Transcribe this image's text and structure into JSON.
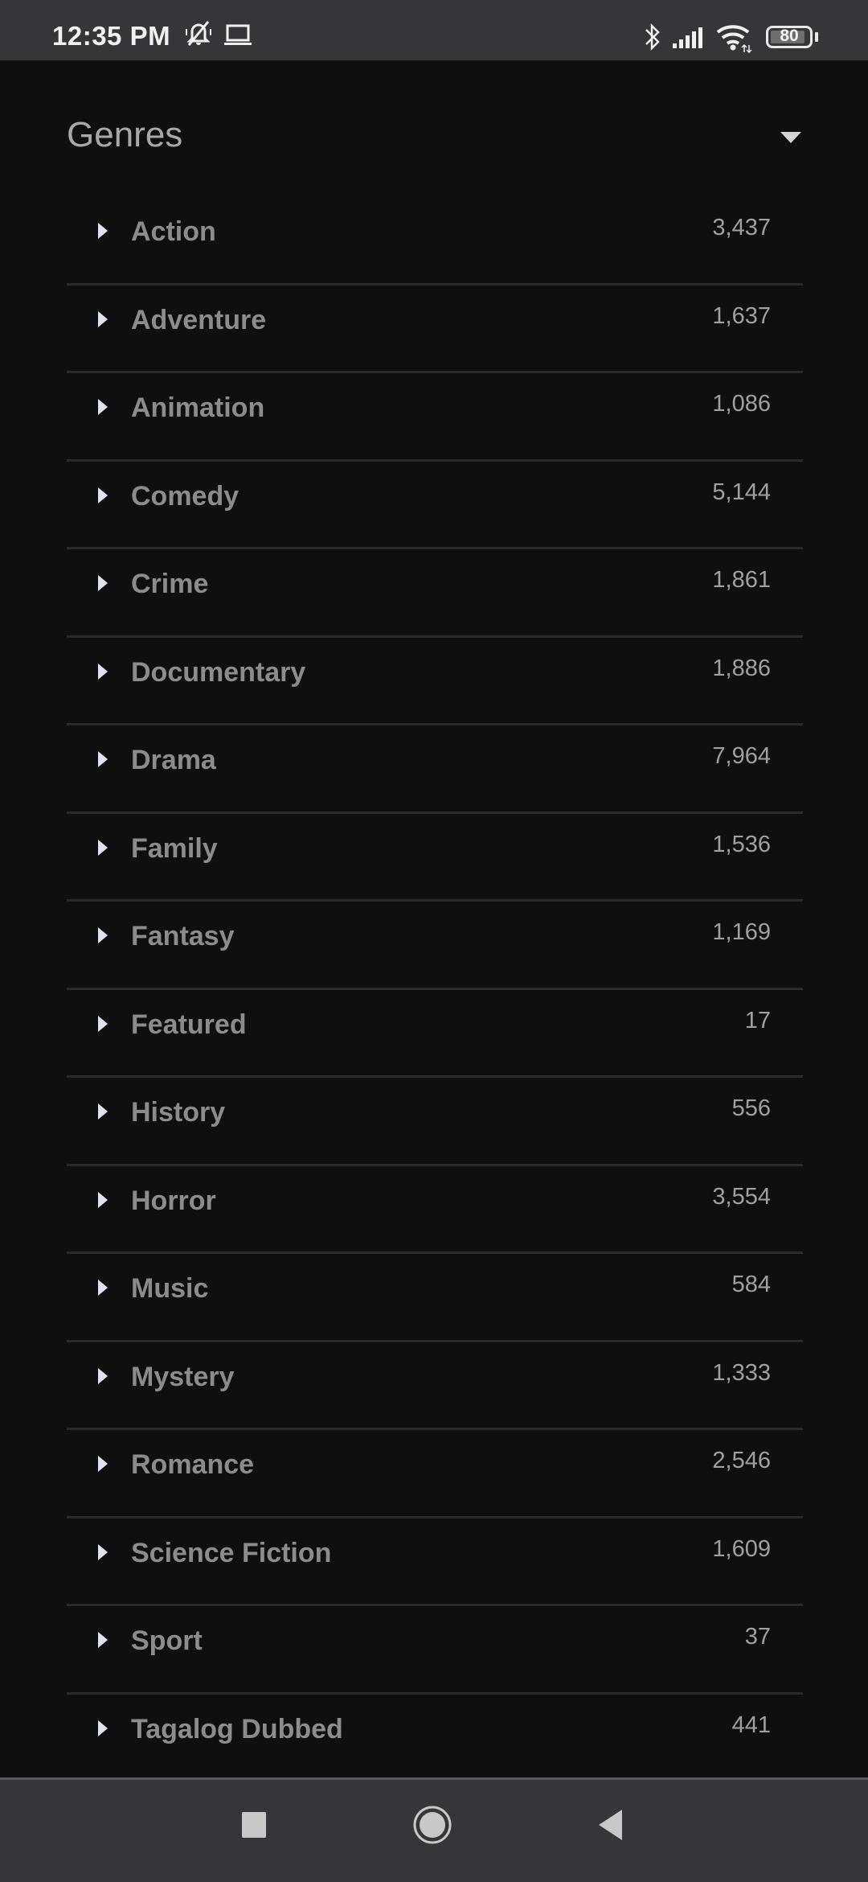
{
  "status_bar": {
    "time": "12:35 PM",
    "left_icons": [
      "bell-muted-icon",
      "laptop-icon"
    ],
    "right_icons": [
      "bluetooth-icon",
      "signal-icon",
      "wifi-icon",
      "battery-icon"
    ],
    "battery_level": "80"
  },
  "section": {
    "title": "Genres",
    "toggle_icon": "caret-down-icon",
    "expanded": true
  },
  "genres": [
    {
      "label": "Action",
      "count": "3,437"
    },
    {
      "label": "Adventure",
      "count": "1,637"
    },
    {
      "label": "Animation",
      "count": "1,086"
    },
    {
      "label": "Comedy",
      "count": "5,144"
    },
    {
      "label": "Crime",
      "count": "1,861"
    },
    {
      "label": "Documentary",
      "count": "1,886"
    },
    {
      "label": "Drama",
      "count": "7,964"
    },
    {
      "label": "Family",
      "count": "1,536"
    },
    {
      "label": "Fantasy",
      "count": "1,169"
    },
    {
      "label": "Featured",
      "count": "17"
    },
    {
      "label": "History",
      "count": "556"
    },
    {
      "label": "Horror",
      "count": "3,554"
    },
    {
      "label": "Music",
      "count": "584"
    },
    {
      "label": "Mystery",
      "count": "1,333"
    },
    {
      "label": "Romance",
      "count": "2,546"
    },
    {
      "label": "Science Fiction",
      "count": "1,609"
    },
    {
      "label": "Sport",
      "count": "37"
    },
    {
      "label": "Tagalog Dubbed",
      "count": "441"
    }
  ],
  "nav_bar": {
    "buttons": [
      "recents-button",
      "home-button",
      "back-button"
    ]
  },
  "colors": {
    "background": "#0f0f10",
    "system_bar": "#35363a",
    "label_text": "#8c8c8c",
    "count_text": "#a0a0a0",
    "divider": "#2a2a2c"
  }
}
